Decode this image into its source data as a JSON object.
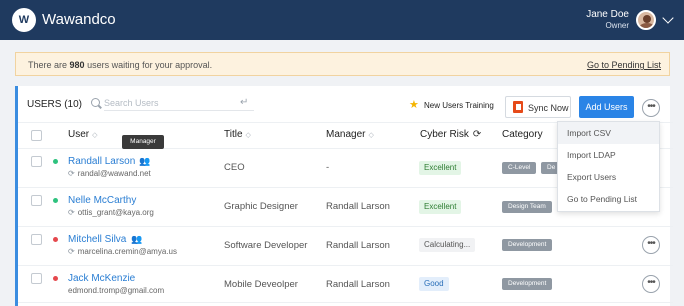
{
  "app": {
    "logo_letter": "W",
    "brand": "Wawandco"
  },
  "user": {
    "name": "Jane Doe",
    "role": "Owner"
  },
  "banner": {
    "text_before": "There are ",
    "count": "980",
    "text_after": " users waiting for your approval.",
    "link": "Go to Pending List"
  },
  "toolbar": {
    "title": "USERS (10)",
    "search_placeholder": "Search Users",
    "training_label": "New Users Training",
    "sync_label": "Sync Now",
    "add_label": "Add Users",
    "more_glyph": "•••"
  },
  "columns": {
    "user": "User",
    "title": "Title",
    "manager": "Manager",
    "cyber_risk": "Cyber Risk",
    "category": "Category"
  },
  "tooltip": "Manager",
  "menu": [
    "Import CSV",
    "Import LDAP",
    "Export Users",
    "Go to Pending List"
  ],
  "rows": [
    {
      "name": "Randall Larson",
      "email": "randal@wawand.net",
      "title": "CEO",
      "manager": "-",
      "risk": "Excellent",
      "categories": [
        "C-Level",
        "De"
      ],
      "status_color": "#2ec27e"
    },
    {
      "name": "Nelle McCarthy",
      "email": "ottis_grant@kaya.org",
      "title": "Graphic Designer",
      "manager": "Randall Larson",
      "risk": "Excellent",
      "categories": [
        "Design Team"
      ],
      "status_color": "#2ec27e"
    },
    {
      "name": "Mitchell Silva",
      "email": "marcelina.cremin@amya.us",
      "title": "Software Developer",
      "manager": "Randall Larson",
      "risk": "Calculating...",
      "categories": [
        "Development"
      ],
      "status_color": "#e5484d"
    },
    {
      "name": "Jack McKenzie",
      "email": "edmond.tromp@gmail.com",
      "title": "Mobile Deveolper",
      "manager": "Randall Larson",
      "risk": "Good",
      "categories": [
        "Development"
      ],
      "status_color": "#e5484d"
    }
  ]
}
